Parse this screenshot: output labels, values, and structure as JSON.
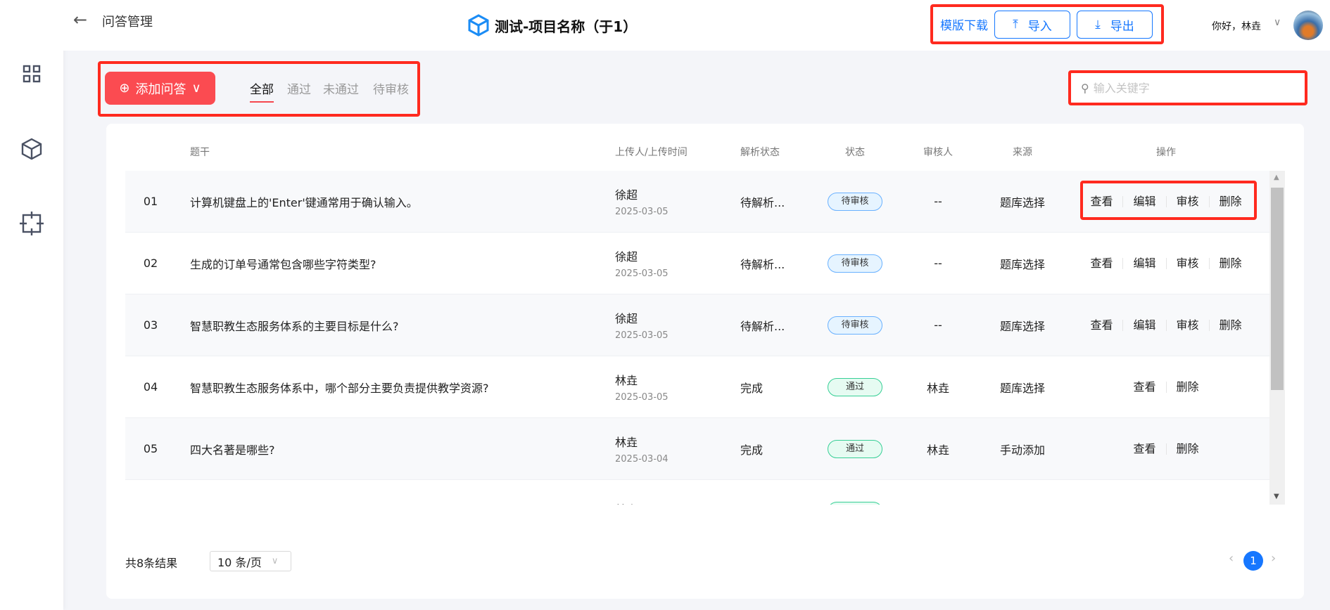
{
  "header": {
    "page_title": "问答管理",
    "project_title": "测试-项目名称（于1）",
    "template_download": "模版下载",
    "import_label": "导入",
    "export_label": "导出",
    "greeting": "你好，林垚"
  },
  "sidebar": {
    "items": [
      {
        "icon": "grid-icon"
      },
      {
        "icon": "cube-icon"
      },
      {
        "icon": "crosshair-icon"
      }
    ]
  },
  "toolbar": {
    "add_label": "添加问答",
    "tabs": [
      {
        "label": "全部",
        "active": true
      },
      {
        "label": "通过"
      },
      {
        "label": "未通过"
      },
      {
        "label": "待审核"
      }
    ],
    "search_placeholder": "输入关键字"
  },
  "table": {
    "columns": [
      "",
      "题干",
      "上传人/上传时间",
      "解析状态",
      "状态",
      "审核人",
      "来源",
      "操作"
    ],
    "rows": [
      {
        "no": "01",
        "title": "计算机键盘上的'Enter'键通常用于确认输入。",
        "uploader": "徐超",
        "date": "2025-03-05",
        "parse": "待解析...",
        "status": "待审核",
        "reviewer": "--",
        "source": "题库选择",
        "ops": [
          "查看",
          "编辑",
          "审核",
          "删除"
        ]
      },
      {
        "no": "02",
        "title": "生成的订单号通常包含哪些字符类型?",
        "uploader": "徐超",
        "date": "2025-03-05",
        "parse": "待解析...",
        "status": "待审核",
        "reviewer": "--",
        "source": "题库选择",
        "ops": [
          "查看",
          "编辑",
          "审核",
          "删除"
        ]
      },
      {
        "no": "03",
        "title": "智慧职教生态服务体系的主要目标是什么?",
        "uploader": "徐超",
        "date": "2025-03-05",
        "parse": "待解析...",
        "status": "待审核",
        "reviewer": "--",
        "source": "题库选择",
        "ops": [
          "查看",
          "编辑",
          "审核",
          "删除"
        ]
      },
      {
        "no": "04",
        "title": "智慧职教生态服务体系中，哪个部分主要负责提供教学资源?",
        "uploader": "林垚",
        "date": "2025-03-05",
        "parse": "完成",
        "status": "通过",
        "reviewer": "林垚",
        "source": "题库选择",
        "ops": [
          "查看",
          "删除"
        ]
      },
      {
        "no": "05",
        "title": "四大名著是哪些?",
        "uploader": "林垚",
        "date": "2025-03-04",
        "parse": "完成",
        "status": "通过",
        "reviewer": "林垚",
        "source": "手动添加",
        "ops": [
          "查看",
          "删除"
        ]
      },
      {
        "no": "",
        "title": "",
        "uploader": "林垚",
        "date": "",
        "parse": "",
        "status": "通过",
        "reviewer": "",
        "source": "",
        "ops": []
      }
    ]
  },
  "footer": {
    "total": "共8条结果",
    "page_size": "10 条/页",
    "current_page": "1"
  },
  "colors": {
    "primary": "#1677ff",
    "danger": "#fb4b51",
    "pending_badge": "#e6f4ff",
    "pass_badge": "#e6fbf2"
  }
}
